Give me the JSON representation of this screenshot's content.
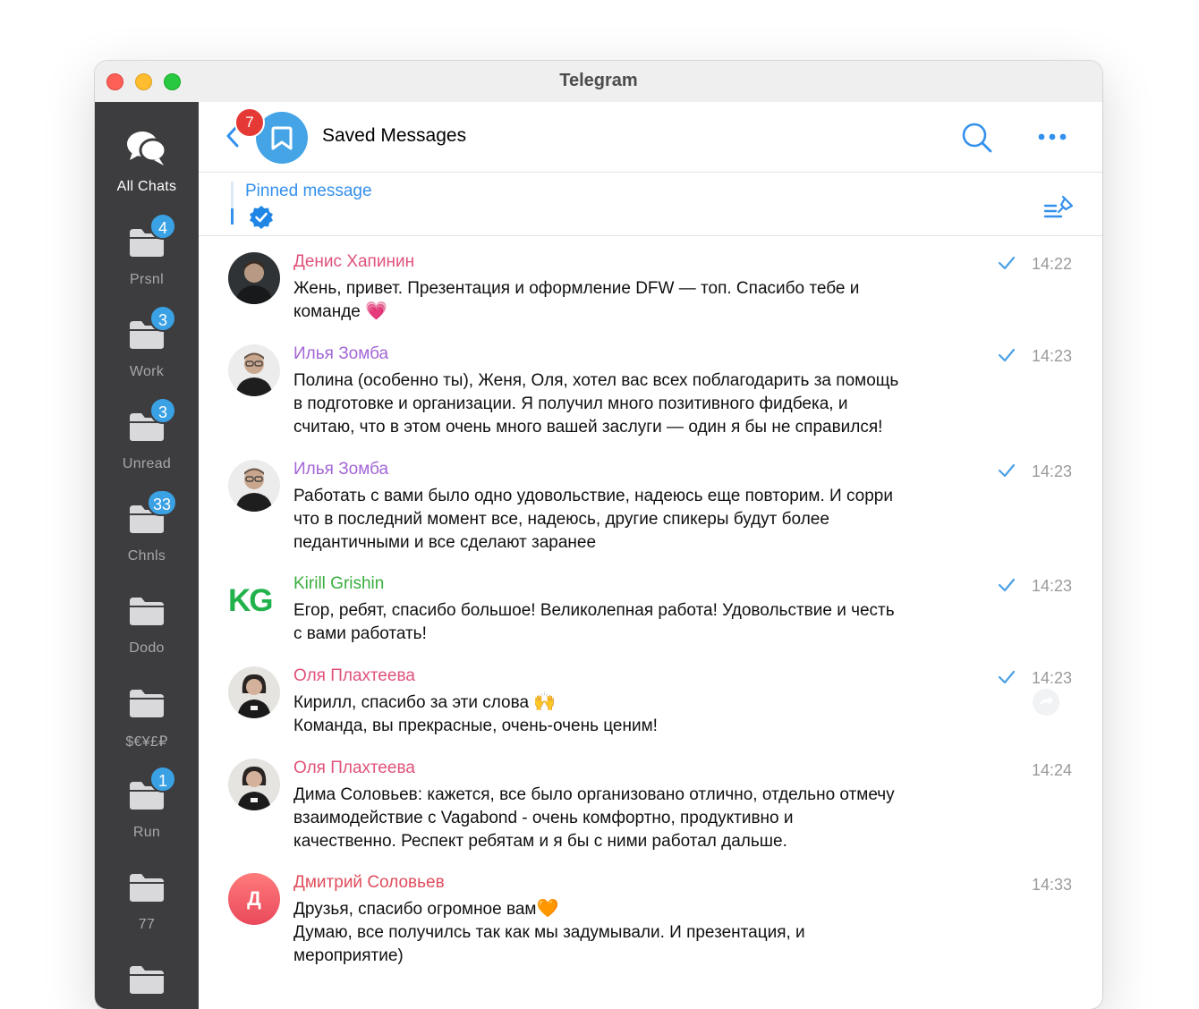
{
  "window": {
    "title": "Telegram"
  },
  "sidebar": {
    "folders": [
      {
        "label": "All Chats",
        "badge": ""
      },
      {
        "label": "Prsnl",
        "badge": "4"
      },
      {
        "label": "Work",
        "badge": "3"
      },
      {
        "label": "Unread",
        "badge": "3"
      },
      {
        "label": "Chnls",
        "badge": "33"
      },
      {
        "label": "Dodo",
        "badge": ""
      },
      {
        "label": "$€¥£₽",
        "badge": ""
      },
      {
        "label": "Run",
        "badge": "1"
      },
      {
        "label": "77",
        "badge": ""
      }
    ]
  },
  "header": {
    "title": "Saved Messages",
    "unread": "7"
  },
  "pinned": {
    "title": "Pinned message"
  },
  "messages": [
    {
      "sender": "Денис Хапинин",
      "color": "#e0527a",
      "time": "14:22",
      "lines": [
        "Жень, привет. Презентация и оформление DFW — топ. Спасибо тебе и",
        "команде"
      ],
      "emoji": "💗"
    },
    {
      "sender": "Илья Зомба",
      "color": "#a366d6",
      "time": "14:23",
      "lines": [
        "Полина (особенно ты), Женя, Оля, хотел вас всех поблагодарить за помощь",
        "в подготовке и организации. Я получил много позитивного фидбека, и",
        "считаю, что в этом очень много вашей заслуги — один я бы не справился!"
      ]
    },
    {
      "sender": "Илья Зомба",
      "color": "#a366d6",
      "time": "14:23",
      "lines": [
        "Работать с вами было одно удовольствие, надеюсь еще повторим. И сорри",
        "что в последний момент все, надеюсь, другие спикеры будут более",
        "педантичными и все сделают заранее"
      ]
    },
    {
      "sender": "Kirill Grishin",
      "color": "#3bae3e",
      "time": "14:23",
      "avatar_text": "KG",
      "lines": [
        "Егор, ребят, спасибо большое! Великолепная работа! Удовольствие и честь",
        "с вами работать!"
      ]
    },
    {
      "sender": "Оля Плахтеева",
      "color": "#e0527a",
      "time": "14:23",
      "lines": [
        "Кирилл, спасибо за эти слова",
        "Команда, вы прекрасные, очень-очень ценим!"
      ],
      "emoji": "🙌"
    },
    {
      "sender": "Оля Плахтеева",
      "color": "#e0527a",
      "time": "14:24",
      "lines": [
        "Дима Соловьев: кажется, все было организовано отлично, отдельно отмечу",
        "взаимодействие с Vagabond - очень комфортно, продуктивно и",
        "качественно. Респект ребятам и я бы с ними работал дальше."
      ]
    },
    {
      "sender": "Дмитрий Соловьев",
      "color": "#e04d5c",
      "time": "14:33",
      "avatar_text": "Д",
      "lines": [
        "Друзья, спасибо огромное вам",
        "Думаю, все получилсь так как мы задумывали. И презентация, и",
        "мероприятие)"
      ],
      "emoji": "🧡"
    }
  ]
}
